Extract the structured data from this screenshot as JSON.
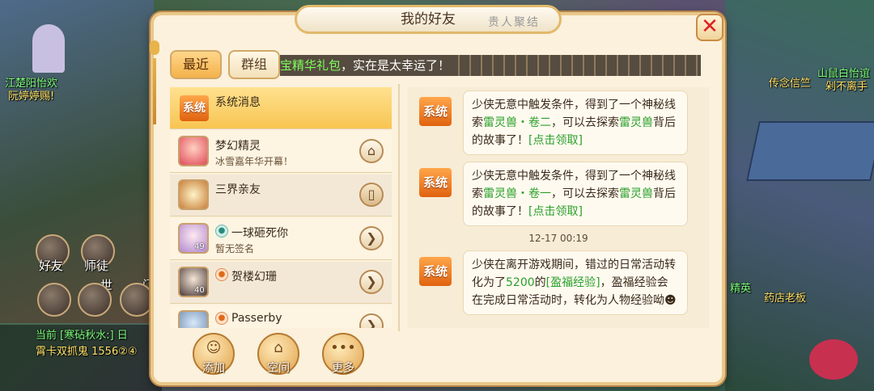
{
  "panel": {
    "title": "我的好友",
    "title_deco": "贵人聚结"
  },
  "background": {
    "texts": [
      {
        "text": "江楚阳怡欢",
        "class": "green"
      },
      {
        "text": "阮婷婷赐!",
        "class": ""
      },
      {
        "text": "传念信竺",
        "class": ""
      },
      {
        "text": "山鼠白怡谊",
        "class": "green"
      },
      {
        "text": "剁不离手",
        "class": ""
      },
      {
        "text": "药店老板",
        "class": ""
      },
      {
        "text": "精英",
        "class": ""
      }
    ],
    "side_buttons": [
      "好友",
      "师徒",
      "世",
      "门"
    ],
    "chat_lines": [
      "当前 [寒砧秋水:] 日",
      "霄卡双抓鬼 1556②④"
    ]
  },
  "tabs": [
    {
      "label": "最近",
      "active": true
    },
    {
      "label": "群组",
      "active": false
    }
  ],
  "marquee": {
    "highlight": "宝精华礼包",
    "text": "，实在是太幸运了！"
  },
  "contacts": [
    {
      "name": "系统消息",
      "status": "",
      "type": "system",
      "badge": "系统",
      "icon": ""
    },
    {
      "name": "梦幻精灵",
      "status": "冰雪嘉年华开幕！",
      "type": "npc",
      "icon": "home-icon",
      "glyph": "⌂"
    },
    {
      "name": "三界亲友",
      "status": "",
      "type": "npc",
      "icon": "book-icon",
      "glyph": "▯"
    },
    {
      "name": "一球砸死你",
      "status": "暂无签名",
      "type": "friend",
      "level": "49",
      "icon": "arrow-right-icon",
      "glyph": "❯"
    },
    {
      "name": "贺楼幻珊",
      "status": "",
      "type": "friend",
      "level": "40",
      "icon": "arrow-right-icon",
      "glyph": "❯"
    },
    {
      "name": "Passerby",
      "status": "",
      "type": "friend",
      "icon": "arrow-right-icon",
      "glyph": "❯"
    }
  ],
  "actions": [
    {
      "label": "添加"
    },
    {
      "label": "空间"
    },
    {
      "label": "更多"
    }
  ],
  "messages": [
    {
      "badge": "系统",
      "p1": "少侠无意中触发条件，得到了一个神秘线索",
      "g1": "雷灵兽・卷二",
      "p2": "，可以去探索",
      "g2": "雷灵兽",
      "p3": "背后的故事了！",
      "g3": "[点击领取]"
    },
    {
      "badge": "系统",
      "p1": "少侠无意中触发条件，得到了一个神秘线索",
      "g1": "雷灵兽・卷一",
      "p2": "，可以去探索",
      "g2": "雷灵兽",
      "p3": "背后的故事了！",
      "g3": "[点击领取]"
    },
    {
      "time": "12-17 00:19",
      "badge": "系统",
      "p1": "少侠在离开游戏期间，错过的日常活动转化为了",
      "g1": "5200",
      "p2": "的",
      "g2": "[盈福经验]",
      "p3": "，盈福经验会在完成日常活动时，转化为人物经验呦"
    }
  ],
  "colors": {
    "accent": "#f4b24c",
    "highlight_green": "#2aa02a",
    "close_red": "#dd2222",
    "system_badge": "#e0620f"
  }
}
